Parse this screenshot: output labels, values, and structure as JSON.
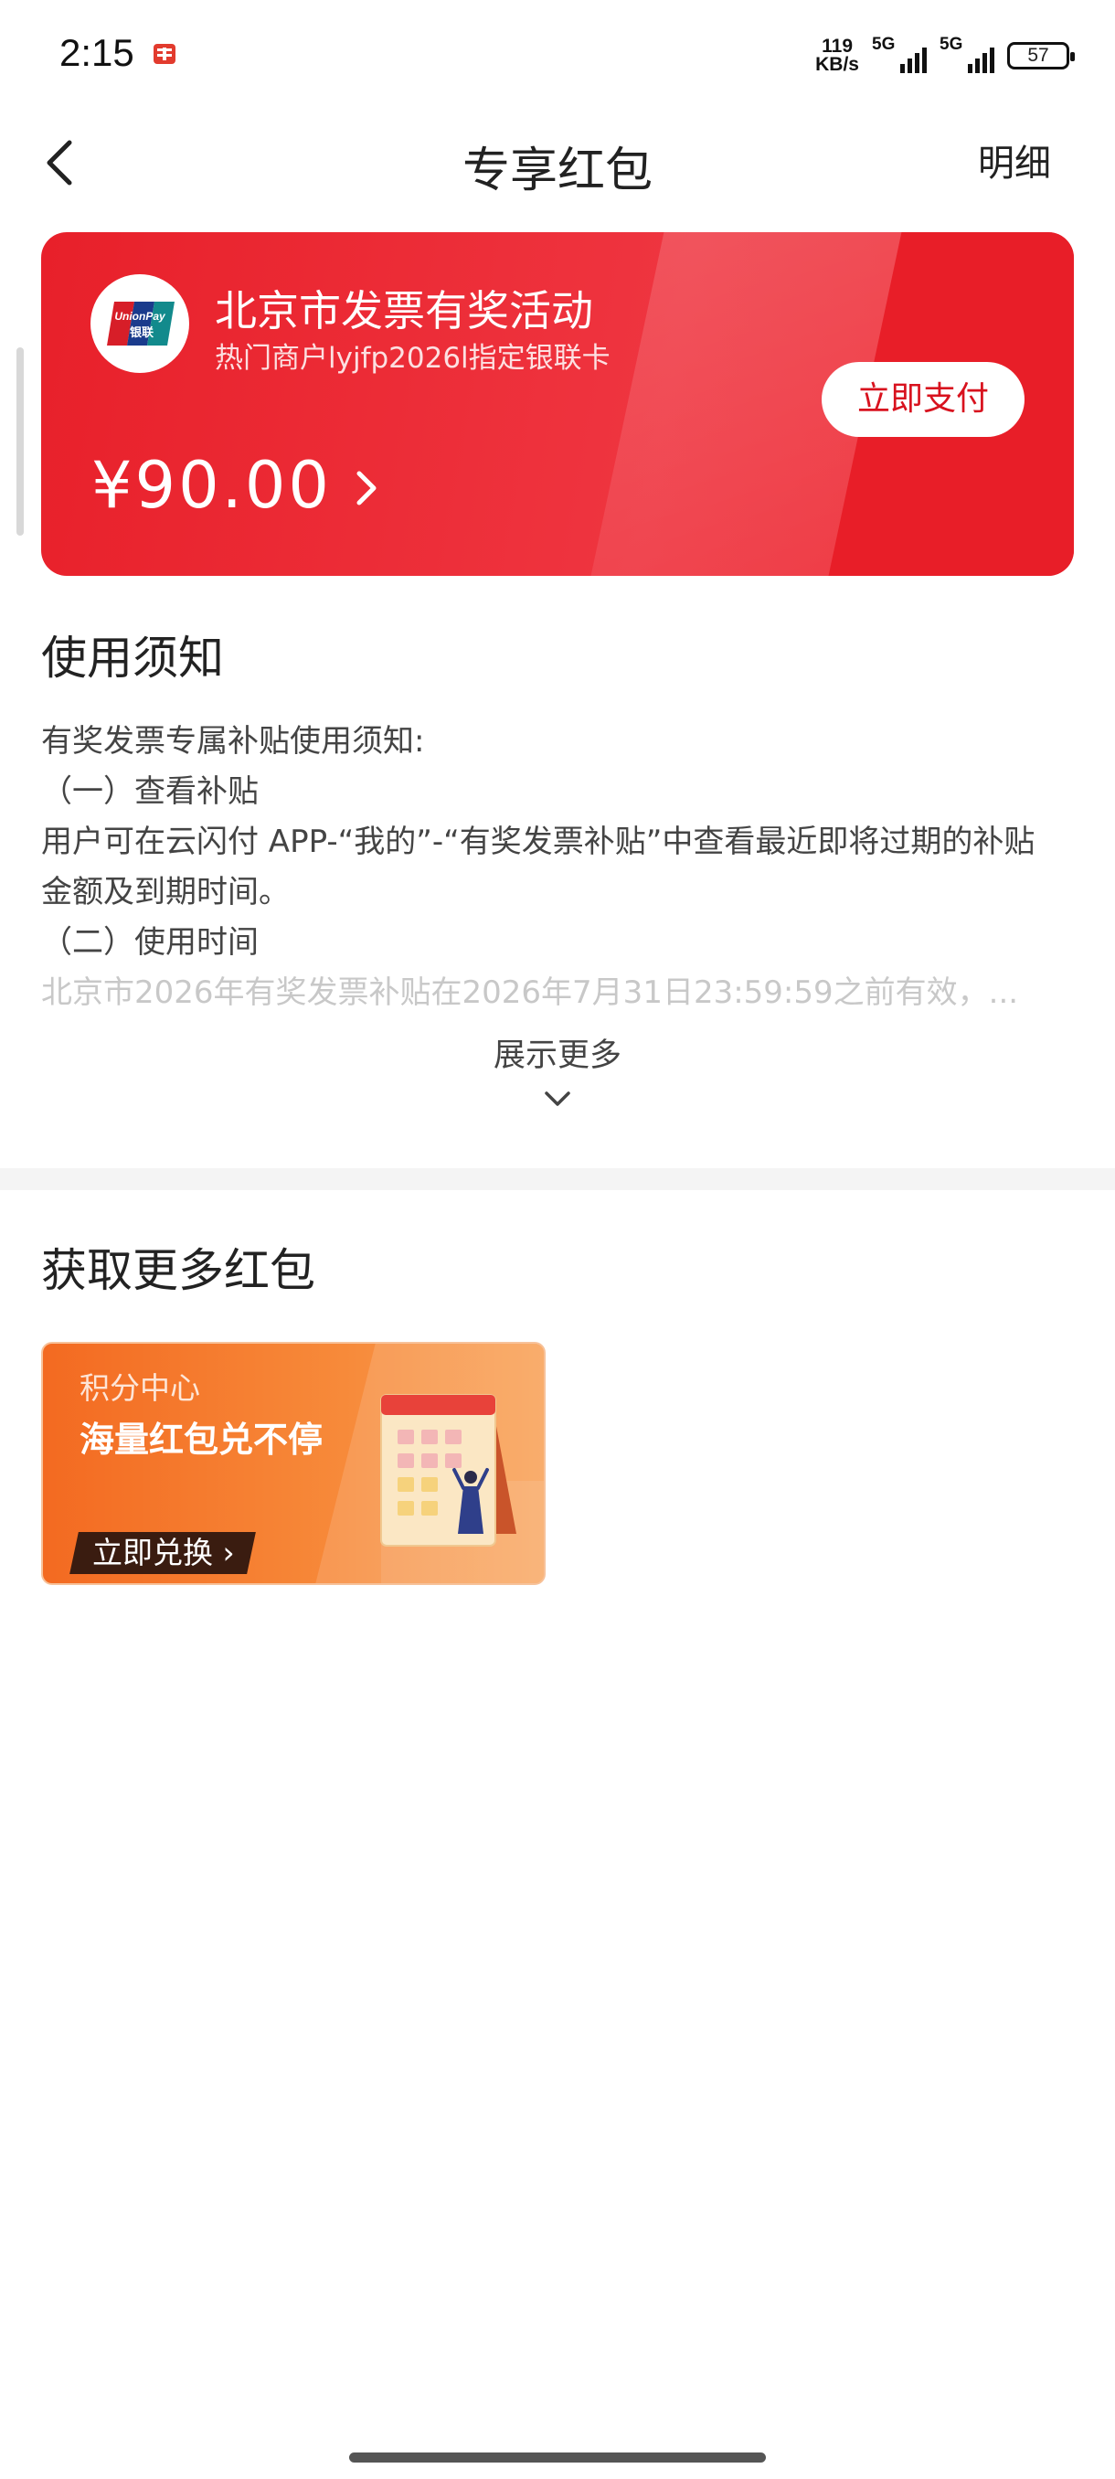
{
  "status_bar": {
    "time": "2:15",
    "net_speed_value": "119",
    "net_speed_unit": "KB/s",
    "signal1_label": "5G",
    "signal2_label": "5G",
    "battery_level": "57"
  },
  "nav": {
    "title": "专享红包",
    "detail_label": "明细"
  },
  "coupon": {
    "title": "北京市发票有奖活动",
    "subtitle": "热门商户lyjfp2026l指定银联卡",
    "pay_button": "立即支付",
    "amount": "¥90.00",
    "logo_text_top": "UnionPay",
    "logo_text_bottom": "银联"
  },
  "notice": {
    "heading": "使用须知",
    "lines": [
      "有奖发票专属补贴使用须知:",
      "（一）查看补贴",
      "用户可在云闪付 APP-“我的”-“有奖发票补贴”中查看最近即将过期的补贴",
      "金额及到期时间。",
      "（二）使用时间",
      "北京市2026年有奖发票补贴在2026年7月31日23:59:59之前有效，..."
    ],
    "show_more": "展示更多"
  },
  "more": {
    "heading": "获取更多红包",
    "card_label": "积分中心",
    "card_title": "海量红包兑不停",
    "card_button": "立即兑换 ›"
  }
}
